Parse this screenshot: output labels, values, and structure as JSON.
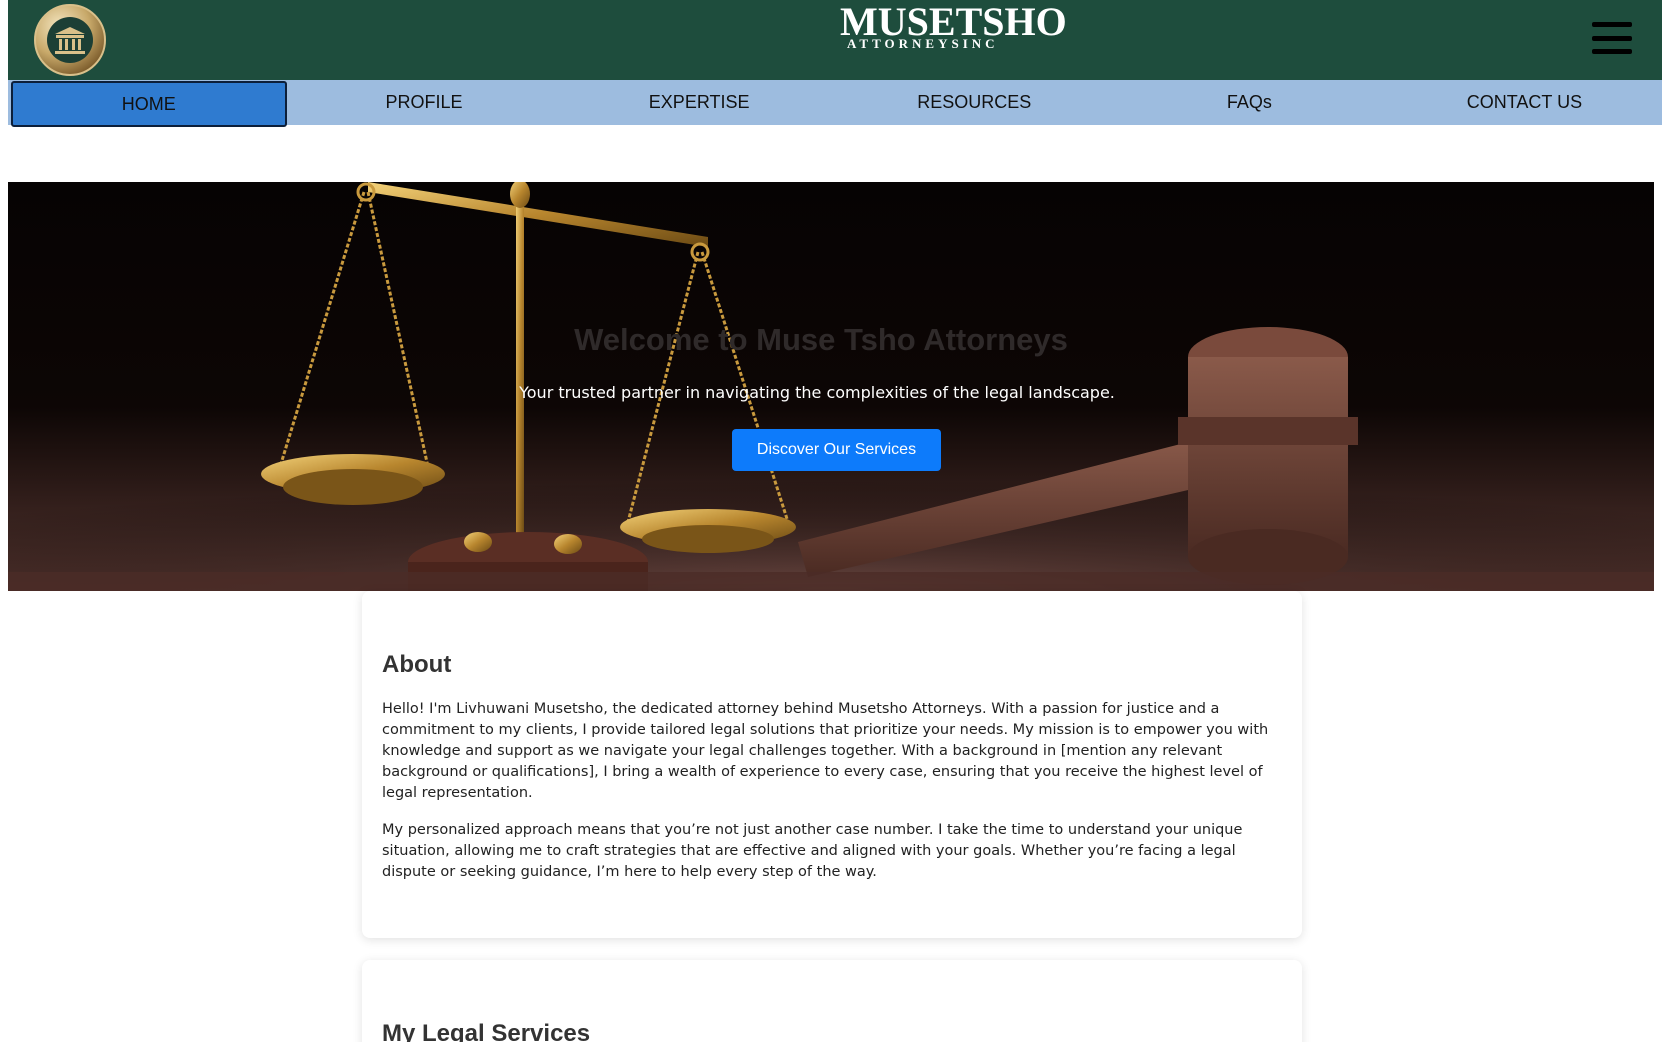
{
  "header": {
    "brand_name": "MUSETSHO",
    "brand_sub": "ATTORNEYSINC",
    "menu_icon": "hamburger-menu-icon",
    "logo_icon": "courthouse-icon"
  },
  "nav": {
    "items": [
      {
        "label": "HOME"
      },
      {
        "label": "PROFILE"
      },
      {
        "label": "EXPERTISE"
      },
      {
        "label": "RESOURCES"
      },
      {
        "label": "FAQs"
      },
      {
        "label": "CONTACT US"
      }
    ],
    "active_index": 0
  },
  "hero": {
    "title": "Welcome to Muse Tsho Attorneys",
    "subtitle": "Your trusted partner in navigating the complexities of the legal landscape.",
    "button_label": "Discover Our Services"
  },
  "about": {
    "heading": "About",
    "paragraphs": [
      "Hello! I'm Livhuwani Musetsho, the dedicated attorney behind Musetsho Attorneys. With a passion for justice and a commitment to my clients, I provide tailored legal solutions that prioritize your needs. My mission is to empower you with knowledge and support as we navigate your legal challenges together. With a background in [mention any relevant background or qualifications], I bring a wealth of experience to every case, ensuring that you receive the highest level of legal representation.",
      "My personalized approach means that you’re not just another case number. I take the time to understand your unique situation, allowing me to craft strategies that are effective and aligned with your goals. Whether you’re facing a legal dispute or seeking guidance, I’m here to help every step of the way."
    ]
  },
  "services": {
    "heading": "My Legal Services"
  },
  "colors": {
    "header_bg": "#1e4d3d",
    "nav_bg": "#9dbcdf",
    "nav_active": "#2f7bd0",
    "cta": "#0d7bfb"
  }
}
